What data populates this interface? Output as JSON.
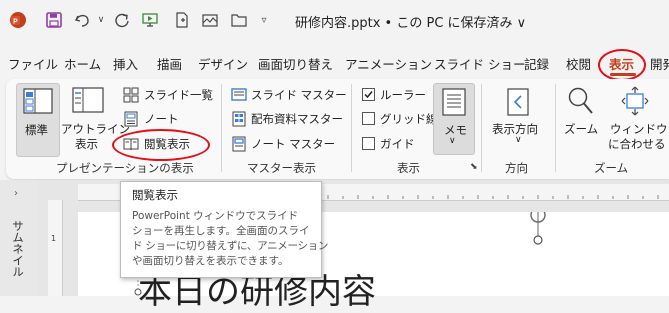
{
  "titlebar": {
    "doc_title": "研修内容.pptx • この PC に保存済み ∨"
  },
  "tabs": [
    "ファイル",
    "ホーム",
    "挿入",
    "描画",
    "デザイン",
    "画面切り替え",
    "アニメーション",
    "スライド ショー",
    "記録",
    "校閲",
    "表示",
    "開発"
  ],
  "active_tab": "表示",
  "ribbon": {
    "presentation_views": {
      "normal": "標準",
      "outline_1": "アウトライン",
      "outline_2": "表示",
      "slide_sorter": "スライド一覧",
      "notes": "ノート",
      "reading": "閲覧表示",
      "group": "プレゼンテーションの表示"
    },
    "master_views": {
      "slide_master": "スライド マスター",
      "handout_master": "配布資料マスター",
      "notes_master": "ノート マスター",
      "group": "マスター表示"
    },
    "show": {
      "ruler": "ルーラー",
      "gridlines": "グリッド線",
      "guides": "ガイド",
      "ruler_checked": true,
      "group": "表示",
      "notes_button": "メモ"
    },
    "direction": {
      "button": "表示方向",
      "group": "方向"
    },
    "zoom": {
      "zoom": "ズーム",
      "fit_1": "ウィンドウ",
      "fit_2": "に合わせる",
      "group": "ズーム"
    }
  },
  "thumbnail_label": "サムネイル",
  "tooltip": {
    "title": "閲覧表示",
    "lines": [
      "PowerPoint ウィンドウでスライド",
      "ショーを再生します。全画面のスライ",
      "ド ショーに切り替えずに、アニメーション",
      "や画面切り替えを表示できます。"
    ]
  },
  "slide": {
    "title_text": "本日の研修内容"
  },
  "colors": {
    "annotation": "#e3101a",
    "app_accent": "#c43e1c"
  }
}
